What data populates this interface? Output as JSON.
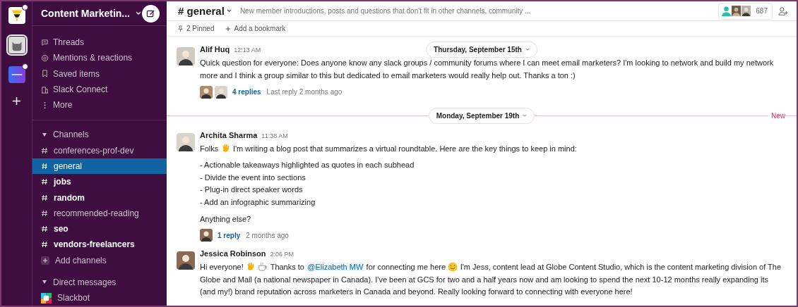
{
  "workspace": {
    "name": "Content Marketin...",
    "switcher": [
      {
        "kind": "funnel",
        "selected": false,
        "badge": true
      },
      {
        "kind": "cat",
        "selected": true
      },
      {
        "kind": "blue",
        "selected": false,
        "badge": true
      }
    ]
  },
  "nav": [
    "Threads",
    "Mentions & reactions",
    "Saved items",
    "Slack Connect",
    "More"
  ],
  "channels_section": {
    "title": "Channels",
    "expanded": true,
    "items": [
      {
        "name": "conferences-prof-dev",
        "selected": false,
        "unread": false
      },
      {
        "name": "general",
        "selected": true,
        "unread": false
      },
      {
        "name": "jobs",
        "selected": false,
        "unread": true
      },
      {
        "name": "random",
        "selected": false,
        "unread": true
      },
      {
        "name": "recommended-reading",
        "selected": false,
        "unread": false
      },
      {
        "name": "seo",
        "selected": false,
        "unread": true
      },
      {
        "name": "vendors-freelancers",
        "selected": false,
        "unread": true
      }
    ],
    "add": "Add channels"
  },
  "dm_section": {
    "title": "Direct messages",
    "expanded": true,
    "items": [
      {
        "name": "Slackbot"
      }
    ]
  },
  "header": {
    "channel": "# general",
    "topic": "New member introductions, posts and questions that don't fit in other channels, community ...",
    "member_count": "687"
  },
  "bookmarks": {
    "pinned": "2 Pinned",
    "add": "Add a bookmark"
  },
  "sticky_date": "Thursday, September 15th",
  "messages": [
    {
      "kind": "message",
      "author": "Alif Huq",
      "time": "12:13 AM",
      "segments": [
        {
          "kind": "text",
          "text": "Quick question for everyone: Does anyone know any slack groups / community forums where I can meet email marketers? I'm looking to network and build my network more and I think a group similar to this but dedicated to email marketers would really help out. Thanks a ton :)"
        }
      ],
      "replies": {
        "count": "4 replies",
        "last": "Last reply 2 months ago",
        "avatars": [
          {
            "kind": "person"
          },
          {
            "kind": "person"
          }
        ]
      }
    },
    {
      "kind": "divider",
      "date": "Monday, September 19th",
      "new_label": "New"
    },
    {
      "kind": "message",
      "author": "Archita Sharma",
      "time": "11:38 AM",
      "segments": [
        {
          "kind": "text",
          "text": "Folks"
        },
        {
          "kind": "wave"
        },
        {
          "kind": "text",
          "text": "I'm writing a blog post that summarizes a virtual roundtable. Here are the key things to keep in mind:"
        }
      ],
      "bullets": [
        "- Actionable takeaways highlighted as quotes in each subhead",
        "- Divide the event into sections",
        "- Plug-in direct speaker words",
        "- Add an infographic summarizing"
      ],
      "after": "Anything else?",
      "replies": {
        "count": "1 reply",
        "last": "2 months ago",
        "avatars": [
          {
            "kind": "person"
          }
        ]
      }
    },
    {
      "kind": "message",
      "author": "Jessica Robinson",
      "time": "2:06 PM",
      "segments": [
        {
          "kind": "text",
          "text": "Hi everyone!"
        },
        {
          "kind": "wave"
        },
        {
          "kind": "coffee"
        },
        {
          "kind": "text",
          "text": "Thanks to"
        },
        {
          "kind": "mention",
          "text": "@Elizabeth MW"
        },
        {
          "kind": "text",
          "text": "for connecting me here"
        },
        {
          "kind": "smile"
        },
        {
          "kind": "text",
          "text": "I'm Jess, content lead at Globe Content Studio, which is the content marketing division of The Globe and Mail (a national newspaper in Canada). I've been at GCS for two and a half years now and am looking to spend the next 10-12 months really expanding its (and my!) brand reputation across marketers in Canada and beyond. Really looking forward to connecting with everyone here!"
        }
      ]
    }
  ]
}
